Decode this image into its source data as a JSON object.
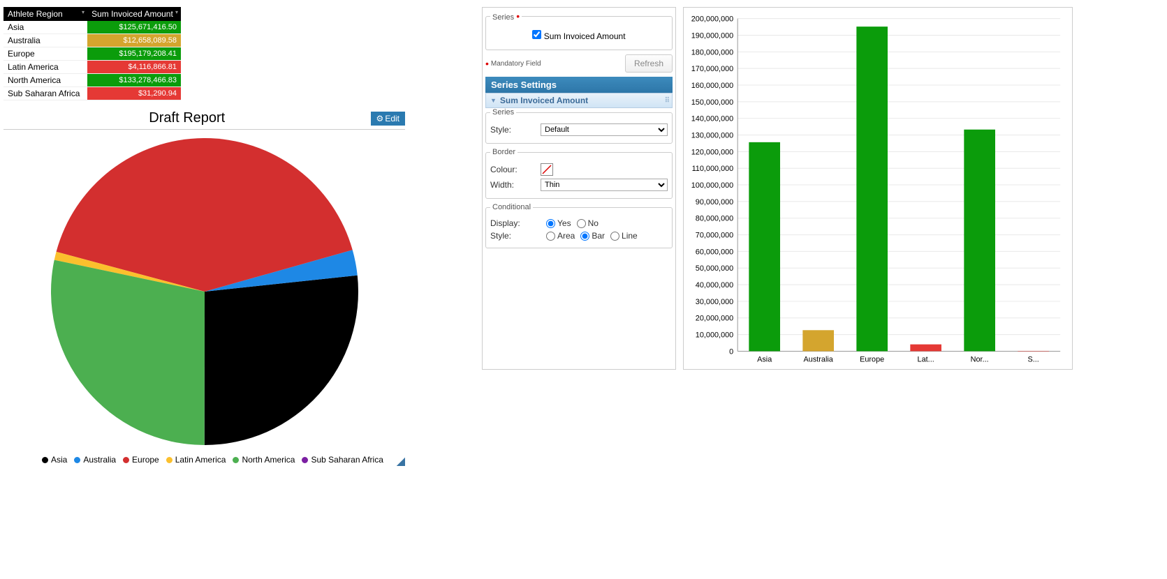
{
  "table": {
    "headers": [
      "Athlete Region",
      "Sum Invoiced Amount"
    ],
    "rows": [
      {
        "region": "Asia",
        "amount": "$125,671,416.50",
        "cls": "row-green"
      },
      {
        "region": "Australia",
        "amount": "$12,658,089.58",
        "cls": "row-gold"
      },
      {
        "region": "Europe",
        "amount": "$195,179,208.41",
        "cls": "row-green"
      },
      {
        "region": "Latin America",
        "amount": "$4,116,866.81",
        "cls": "row-red"
      },
      {
        "region": "North America",
        "amount": "$133,278,466.83",
        "cls": "row-green"
      },
      {
        "region": "Sub Saharan Africa",
        "amount": "$31,290.94",
        "cls": "row-red"
      }
    ]
  },
  "report": {
    "title": "Draft Report",
    "edit": "Edit"
  },
  "pie_legend": [
    {
      "label": "Asia",
      "color": "#000000"
    },
    {
      "label": "Australia",
      "color": "#1e88e5"
    },
    {
      "label": "Europe",
      "color": "#d32f2f"
    },
    {
      "label": "Latin America",
      "color": "#fbc02d"
    },
    {
      "label": "North America",
      "color": "#4caf50"
    },
    {
      "label": "Sub Saharan Africa",
      "color": "#7b1fa2"
    }
  ],
  "settings": {
    "series_legend": "Series",
    "series_chk": "Sum Invoiced Amount",
    "mandatory": "Mandatory Field",
    "refresh": "Refresh",
    "series_settings": "Series Settings",
    "subheader": "Sum Invoiced Amount",
    "series_group": "Series",
    "style_label": "Style:",
    "style_val": "Default",
    "border_group": "Border",
    "colour_label": "Colour:",
    "width_label": "Width:",
    "width_val": "Thin",
    "cond_group": "Conditional",
    "display_label": "Display:",
    "yes": "Yes",
    "no": "No",
    "style2_label": "Style:",
    "area": "Area",
    "bar": "Bar",
    "line": "Line"
  },
  "chart_data": {
    "type": "bar",
    "categories": [
      "Asia",
      "Australia",
      "Europe",
      "Lat...",
      "Nor...",
      "S..."
    ],
    "values": [
      125671416.5,
      12658089.58,
      195179208.41,
      4116866.81,
      133278466.83,
      31290.94
    ],
    "colors": [
      "#0b9c0b",
      "#d4a52e",
      "#0b9c0b",
      "#e53935",
      "#0b9c0b",
      "#e53935"
    ],
    "ylim": [
      0,
      200000000
    ],
    "ystep": 10000000,
    "ylabel": "",
    "xlabel": "",
    "title": ""
  },
  "pie_data": {
    "type": "pie",
    "slices": [
      {
        "label": "Asia",
        "value": 125671416.5,
        "color": "#000000"
      },
      {
        "label": "Australia",
        "value": 12658089.58,
        "color": "#1e88e5"
      },
      {
        "label": "Europe",
        "value": 195179208.41,
        "color": "#d32f2f"
      },
      {
        "label": "Latin America",
        "value": 4116866.81,
        "color": "#fbc02d"
      },
      {
        "label": "North America",
        "value": 133278466.83,
        "color": "#4caf50"
      },
      {
        "label": "Sub Saharan Africa",
        "value": 31290.94,
        "color": "#7b1fa2"
      }
    ]
  }
}
